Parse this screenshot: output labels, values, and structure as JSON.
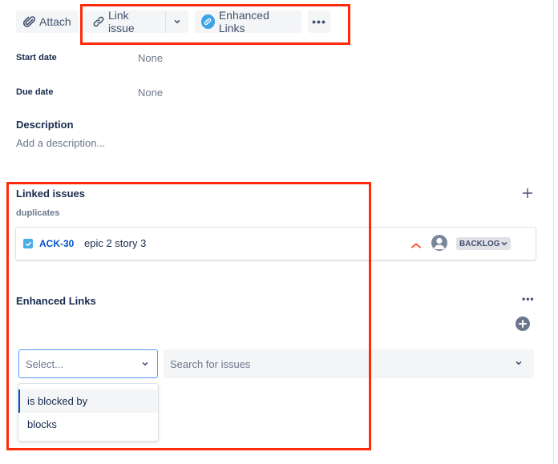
{
  "toolbar": {
    "attach_label": "Attach",
    "link_issue_label": "Link issue",
    "enhanced_links_label": "Enhanced Links",
    "more_label": "•••"
  },
  "fields": {
    "start_date": {
      "label": "Start date",
      "value": "None"
    },
    "due_date": {
      "label": "Due date",
      "value": "None"
    }
  },
  "description": {
    "title": "Description",
    "placeholder": "Add a description..."
  },
  "linked_issues": {
    "title": "Linked issues",
    "groups": [
      {
        "relation": "duplicates",
        "issues": [
          {
            "key": "ACK-30",
            "summary": "epic 2 story 3",
            "priority": "high",
            "status": "BACKLOG"
          }
        ]
      }
    ]
  },
  "enhanced_links": {
    "title": "Enhanced Links",
    "more_label": "•••",
    "select": {
      "placeholder": "Select..."
    },
    "search": {
      "placeholder": "Search for issues"
    },
    "options": [
      {
        "label": "is blocked by",
        "active": true
      },
      {
        "label": "blocks",
        "active": false
      }
    ]
  },
  "colors": {
    "highlight": "#ff2a0a",
    "link": "#0052cc",
    "priority": "#ff5630",
    "focus": "#4c9aff"
  }
}
